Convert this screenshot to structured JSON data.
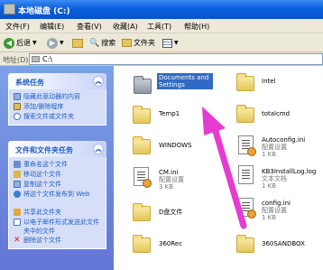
{
  "window": {
    "title": "本地磁盘 (C:)"
  },
  "menu": [
    "文件(F)",
    "编辑(E)",
    "查看(V)",
    "收藏(A)",
    "工具(T)",
    "帮助(H)"
  ],
  "toolbar": {
    "back": "后退",
    "search": "搜索",
    "folders": "文件夹"
  },
  "address": {
    "label": "地址(D)",
    "value": "C:\\"
  },
  "system_tasks": {
    "title": "系统任务",
    "items": [
      "隐藏此驱动器的内容",
      "添加/删除程序",
      "搜索文件或文件夹"
    ]
  },
  "file_tasks": {
    "title": "文件和文件夹任务",
    "items": [
      "重命名这个文件",
      "移动这个文件",
      "复制这个文件",
      "将这个文件发布到 Web",
      "共享此文件夹",
      "以电子邮件形式发送此文件夹中的文件",
      "删除这个文件"
    ]
  },
  "items": [
    {
      "name": "Documents and Settings",
      "type": "folder",
      "selected": true
    },
    {
      "name": "Intel",
      "type": "folder"
    },
    {
      "name": "Temp1",
      "type": "folder"
    },
    {
      "name": "totalcmd",
      "type": "folder"
    },
    {
      "name": "WINDOWS",
      "type": "folder"
    },
    {
      "name": "Autoconfig.ini",
      "type": "file",
      "desc": "配置设置",
      "size": "1 KB"
    },
    {
      "name": "CM.ini",
      "type": "file",
      "desc": "配置设置",
      "size": "3 KB"
    },
    {
      "name": "KB3InstallLog.log",
      "type": "file",
      "desc": "文本文档",
      "size": "1 KB"
    },
    {
      "name": "D盘文件",
      "type": "folder"
    },
    {
      "name": "config.ini",
      "type": "file",
      "desc": "配置设置",
      "size": "1 KB"
    },
    {
      "name": "360Rec",
      "type": "folder"
    },
    {
      "name": "360SANDBOX",
      "type": "folder"
    }
  ],
  "colors": {
    "titlebar": "#0a5fdc",
    "sidebar": "#6375d6",
    "selection": "#316ac5",
    "arrow": "#e53bd1"
  }
}
